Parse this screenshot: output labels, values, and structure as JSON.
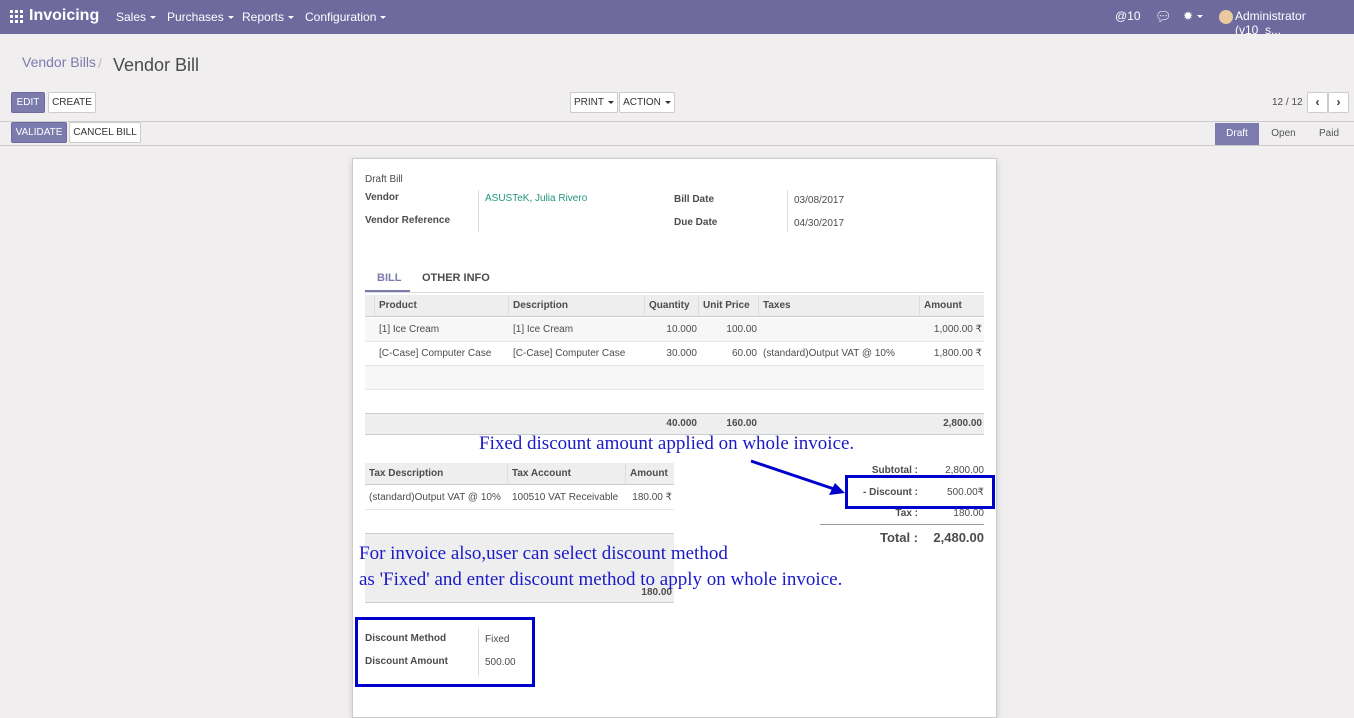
{
  "app": {
    "title": "Invoicing"
  },
  "nav": {
    "menus": [
      "Sales",
      "Purchases",
      "Reports",
      "Configuration"
    ]
  },
  "systray": {
    "mentions": "@10",
    "user": "Administrator (v10_s..."
  },
  "breadcrumb": {
    "parent": "Vendor Bills",
    "separator": "/",
    "current": "Vendor Bill"
  },
  "toolbar": {
    "edit": "EDIT",
    "create": "CREATE",
    "print": "PRINT",
    "action": "ACTION",
    "pager": "12 / 12"
  },
  "header_buttons": {
    "validate": "VALIDATE",
    "cancel": "CANCEL BILL"
  },
  "stages": [
    "Draft",
    "Open",
    "Paid"
  ],
  "bill": {
    "status": "Draft Bill",
    "vendor_label": "Vendor",
    "vendor": "ASUSTeK, Julia Rivero",
    "vendor_ref_label": "Vendor Reference",
    "bill_date_label": "Bill Date",
    "bill_date": "03/08/2017",
    "due_date_label": "Due Date",
    "due_date": "04/30/2017"
  },
  "tabs": [
    "BILL",
    "OTHER INFO"
  ],
  "lines": {
    "headers": [
      "Product",
      "Description",
      "Quantity",
      "Unit Price",
      "Taxes",
      "Amount"
    ],
    "rows": [
      [
        "[1] Ice Cream",
        "[1] Ice Cream",
        "10.000",
        "100.00",
        "",
        "1,000.00 ₹"
      ],
      [
        "[C-Case] Computer Case",
        "[C-Case] Computer Case",
        "30.000",
        "60.00",
        "(standard)Output VAT @ 10%",
        "1,800.00 ₹"
      ]
    ],
    "totals": {
      "quantity": "40.000",
      "unit_price": "160.00",
      "amount": "2,800.00"
    }
  },
  "taxes": {
    "headers": [
      "Tax Description",
      "Tax Account",
      "Amount"
    ],
    "rows": [
      [
        "(standard)Output VAT @ 10%",
        "100510 VAT Receivable",
        "180.00 ₹"
      ]
    ],
    "total": "180.00"
  },
  "summary": {
    "subtotal_label": "Subtotal :",
    "subtotal": "2,800.00",
    "discount_label": "- Discount :",
    "discount": "500.00₹",
    "tax_label": "Tax :",
    "tax": "180.00",
    "total_label": "Total :",
    "total": "2,480.00"
  },
  "discount": {
    "method_label": "Discount Method",
    "method": "Fixed",
    "amount_label": "Discount Amount",
    "amount": "500.00"
  },
  "annotations": {
    "top": "Fixed discount amount applied on whole invoice.",
    "line1": "For invoice also,user can select discount method",
    "line2": "as 'Fixed' and enter discount method to apply on whole invoice."
  },
  "colors": {
    "brand": "#6e6a9e",
    "accent": "#7c7bad",
    "annotation": "#0000cc"
  }
}
